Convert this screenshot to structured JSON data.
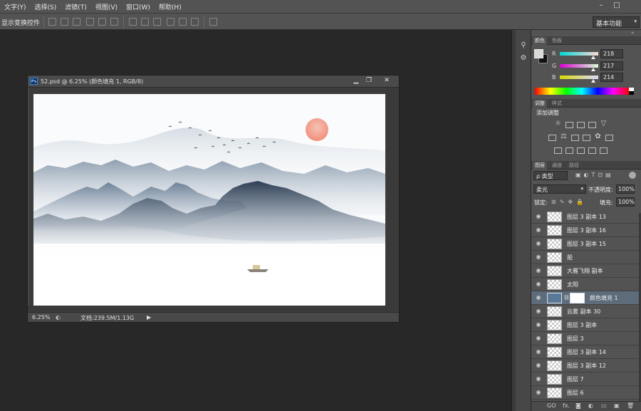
{
  "menubar": {
    "items": [
      "文字(Y)",
      "选择(S)",
      "滤镜(T)",
      "视图(V)",
      "窗口(W)",
      "帮助(H)"
    ],
    "window_controls": [
      "–",
      "□"
    ]
  },
  "options_bar": {
    "show_transform_label": "显示变换控件",
    "workspace": "基本功能"
  },
  "document": {
    "title": "52.psd @ 6.25% (颜色填充 1, RGB/8)",
    "ps_badge": "Ps",
    "window_buttons": [
      "▁",
      "❐",
      "✕"
    ],
    "zoom": "6.25%",
    "doc_info": "文档:239.5M/1.13G"
  },
  "color_panel": {
    "tabs": [
      "颜色",
      "色板"
    ],
    "r_label": "R",
    "g_label": "G",
    "b_label": "B",
    "r": "218",
    "g": "217",
    "b": "214",
    "fg_color": "#dad9d6"
  },
  "adjust_panel": {
    "tabs": [
      "调整",
      "样式"
    ],
    "add_label": "添加调整"
  },
  "layers_panel": {
    "tabs": [
      "图层",
      "通道",
      "路径"
    ],
    "filter_kind": "ρ 类型",
    "blend_mode": "柔光",
    "opacity_label": "不透明度:",
    "opacity": "100%",
    "lock_label": "锁定:",
    "fill_label": "填充:",
    "fill": "100%",
    "layers": [
      {
        "name": "图层 3 副本 13"
      },
      {
        "name": "图层 3 副本 16"
      },
      {
        "name": "图层 3 副本 15"
      },
      {
        "name": "船"
      },
      {
        "name": "大雁飞翔 副本"
      },
      {
        "name": "太阳"
      },
      {
        "name": "颜色填充 1",
        "selected": true
      },
      {
        "name": "云雾 副本 30"
      },
      {
        "name": "图层 3 副本"
      },
      {
        "name": "图层 3"
      },
      {
        "name": "图层 3 副本 14"
      },
      {
        "name": "图层 3 副本 12"
      },
      {
        "name": "图层 7"
      },
      {
        "name": "图层 6"
      }
    ],
    "bottom_icons": [
      "GO",
      "fx."
    ]
  },
  "colors": {
    "sun": "#f4b8a8",
    "mountain_dark": "#3a4a5e",
    "mountain_light": "#8ea0b4"
  }
}
